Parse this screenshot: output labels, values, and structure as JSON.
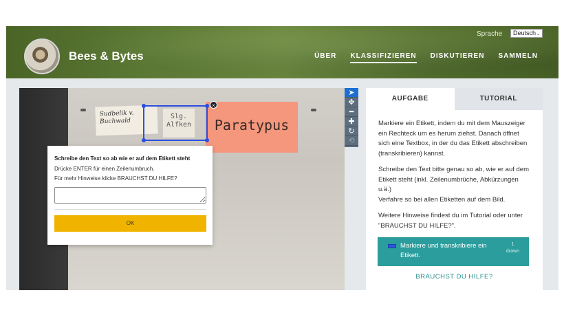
{
  "header": {
    "title": "Bees & Bytes",
    "language_label": "Sprache",
    "language_value": "Deutsch",
    "nav": [
      "ÜBER",
      "KLASSIFIZIEREN",
      "DISKUTIEREN",
      "SAMMELN"
    ],
    "active_nav": "KLASSIFIZIEREN"
  },
  "specimen_labels": {
    "label1": "Sudbelik v. Buchwald",
    "label2": "Slg. Alfken",
    "label3": "Paratypus"
  },
  "dialog": {
    "title": "Schreibe den Text so ab wie er auf dem Etikett steht",
    "line1": "Drücke ENTER für einen Zeilenumbruch.",
    "line2": "Für mehr Hinweise klicke BRAUCHST DU HILFE?",
    "input_value": "",
    "ok_label": "OK"
  },
  "toolbar": {
    "icons": [
      "pointer-icon",
      "move-icon",
      "minus-icon",
      "plus-icon",
      "reset-icon",
      "rotate-icon"
    ]
  },
  "panel": {
    "tabs": [
      "AUFGABE",
      "TUTORIAL"
    ],
    "active_tab": "AUFGABE",
    "para1": "Markiere ein Etikett, indem du mit dem Mauszeiger ein Rechteck um es herum ziehst. Danach öffnet sich eine Textbox, in der du das Etikett abschreiben (transkribieren) kannst.",
    "para2a": "Schreibe den Text bitte genau so ab, wie er auf dem Etikett steht (inkl. Zeilenumbrüche, Abkürzungen u.ä.)",
    "para2b": "Verfahre so bei allen Etiketten auf dem Bild.",
    "para3": "Weitere Hinweise findest du im Tutorial oder unter \"BRAUCHST DU HILFE?\".",
    "task_text": "Markiere und transkribiere ein Etikett.",
    "task_count": "1",
    "task_count_label": "drawn",
    "help_link": "BRAUCHST DU HILFE?"
  },
  "colors": {
    "accent_teal": "#2a9d9c",
    "ok_yellow": "#f0b400",
    "selection_blue": "#2b4ee0"
  }
}
